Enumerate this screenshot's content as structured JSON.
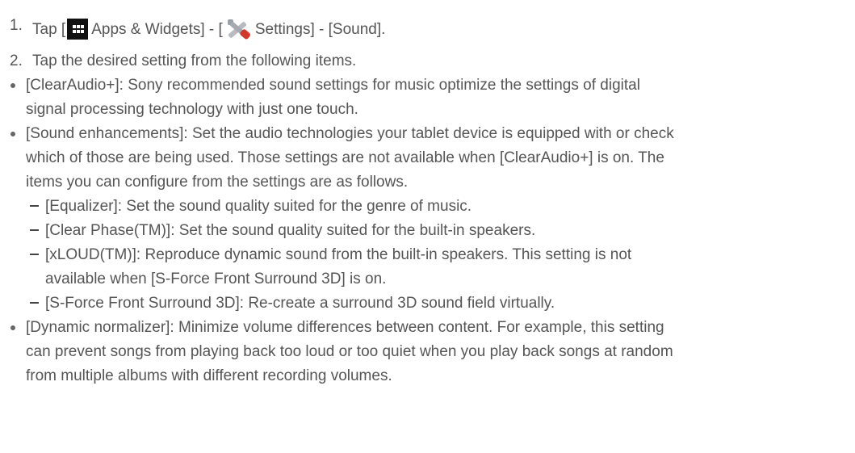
{
  "steps": {
    "s1": {
      "number": "1.",
      "pre": "Tap [",
      "apps_icon": "apps-grid-icon",
      "apps_label": "Apps & Widgets] - [",
      "settings_icon": "settings-tools-icon",
      "settings_label": "Settings] - [Sound]."
    },
    "s2": {
      "number": "2.",
      "text": "Tap the desired setting from the following items."
    }
  },
  "items": {
    "clearaudio": {
      "line1": "[ClearAudio+]: Sony recommended sound settings for music optimize the settings of digital",
      "line2": "signal processing technology with just one touch."
    },
    "sound_enh": {
      "line1": "[Sound enhancements]: Set the audio technologies your tablet device is equipped with or check",
      "line2": "which of those are being used. Those settings are not available when [ClearAudio+] is on. The",
      "line3": "items you can configure from the settings are as follows.",
      "sub": {
        "equalizer": "[Equalizer]: Set the sound quality suited for the genre of music.",
        "clear_phase": "[Clear Phase(TM)]: Set the sound quality suited for the built-in speakers.",
        "xloud_1": "[xLOUD(TM)]: Reproduce dynamic sound from the built-in speakers. This setting is not",
        "xloud_2": "available when [S-Force Front Surround 3D] is on.",
        "sforce": "[S-Force Front Surround 3D]: Re-create a surround 3D sound field virtually."
      }
    },
    "dyn_norm": {
      "line1": "[Dynamic normalizer]: Minimize volume differences between content. For example, this setting",
      "line2": "can prevent songs from playing back too loud or too quiet when you play back songs at random",
      "line3": "from multiple albums with different recording volumes."
    }
  }
}
